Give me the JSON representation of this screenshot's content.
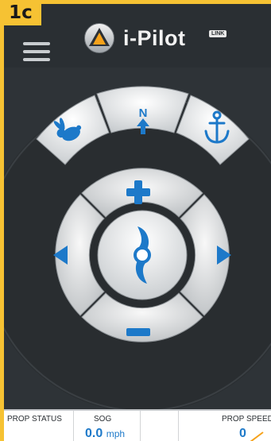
{
  "badge": "1c",
  "app": {
    "brand": "i-Pilot",
    "brand_tag": "LINK"
  },
  "controls": {
    "north_label": "N",
    "buttons": [
      "high-speed-bypass",
      "spot-lock-anchor",
      "speed-up",
      "speed-down",
      "steer-left",
      "steer-right",
      "prop-toggle"
    ]
  },
  "status_bar": {
    "prop_status_label": "PROP STATUS",
    "sog_label": "SOG",
    "sog_value": "0.0",
    "sog_unit": "mph",
    "prop_speed_label": "PROP SPEED",
    "prop_speed_value": "0"
  },
  "colors": {
    "accent": "#1d79c9",
    "highlight": "#f6c233",
    "background": "#2e3337"
  }
}
